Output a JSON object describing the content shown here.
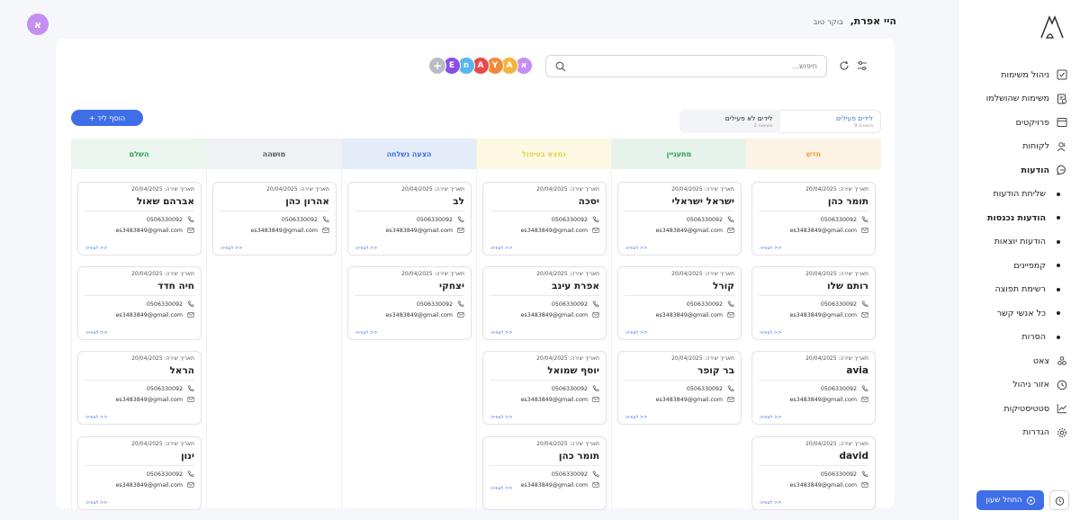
{
  "header": {
    "greeting": "היי אפרת,",
    "subgreeting": "בוקר טוב",
    "user_initial": "א"
  },
  "sidebar": {
    "items": [
      {
        "label": "ניהול משימות",
        "icon": "task-check-icon"
      },
      {
        "label": "משימות שהושלמו",
        "icon": "completed-tasks-icon"
      },
      {
        "label": "פרויקטים",
        "icon": "projects-icon"
      },
      {
        "label": "לקוחות",
        "icon": "customers-icon"
      },
      {
        "label": "הודעות",
        "icon": "chat-bubble-icon"
      }
    ],
    "sub_items": [
      {
        "label": "שליחת הודעות"
      },
      {
        "label": "הודעות נכנסות"
      },
      {
        "label": "הודעות יוצאות"
      },
      {
        "label": "קמפיינים"
      },
      {
        "label": "רשימת תפוצה"
      },
      {
        "label": "כל אנשי קשר"
      },
      {
        "label": "הסרות"
      }
    ],
    "bottom_items": [
      {
        "label": "צאט",
        "icon": "bot-icon"
      },
      {
        "label": "אזור ניהול",
        "icon": "clock-icon"
      },
      {
        "label": "סטטיסטיקות",
        "icon": "chart-icon"
      },
      {
        "label": "הגדרות",
        "icon": "gear-icon"
      }
    ],
    "start_shift_label": "התחל שעון"
  },
  "toolbar": {
    "search_placeholder": "חיפוש...",
    "add_lead_label": "+ הוסף ליד"
  },
  "avatars": [
    {
      "letter": "א",
      "color": "#c48ef2"
    },
    {
      "letter": "A",
      "color": "#f4b43c"
    },
    {
      "letter": "Y",
      "color": "#f08a3c"
    },
    {
      "letter": "A",
      "color": "#e84a4a"
    },
    {
      "letter": "ח",
      "color": "#58b8ec"
    },
    {
      "letter": "E",
      "color": "#8a4ee8"
    },
    {
      "letter": "+",
      "color": "#b8bcc4"
    }
  ],
  "tabs": [
    {
      "label": "לידים לא פעילים",
      "count": "2 משימות"
    },
    {
      "label": "לידים פעילים",
      "count": "9 משימות"
    }
  ],
  "columns": [
    {
      "title": "השלם",
      "bg": "#eaf5ee",
      "fg": "#2f9e57"
    },
    {
      "title": "מושהה",
      "bg": "#f0f1f4",
      "fg": "#555"
    },
    {
      "title": "הצעה נשלחה",
      "bg": "#e4ecfa",
      "fg": "#3f6ee8"
    },
    {
      "title": "נמצא בטיפול",
      "bg": "#fcf8e2",
      "fg": "#e8d24a"
    },
    {
      "title": "מתעניין",
      "bg": "#e6f3ea",
      "fg": "#2f9e57"
    },
    {
      "title": "חדש",
      "bg": "#fdf3e4",
      "fg": "#f0a040"
    }
  ],
  "card_common": {
    "date_label": "תאריך יצירה: 20/04/2025",
    "phone": "0506330092",
    "email": "es3483849@gmail.com",
    "more_label": "לצפייה >>"
  },
  "cards": {
    "done": [
      "אברהם שאול",
      "חיה חדד",
      "הראל",
      "ינון"
    ],
    "paused": [
      "אהרון כהן"
    ],
    "sent": [
      "לב",
      "יצחקי"
    ],
    "handling": [
      "יסכה",
      "אפרת עינב",
      "יוסף שמואל",
      "תומר כהן"
    ],
    "interested": [
      "ישראל ישראלי",
      "קורל",
      "בר קופר"
    ],
    "new": [
      "תומר כהן",
      "רותם שלו",
      "avia",
      "david"
    ]
  }
}
